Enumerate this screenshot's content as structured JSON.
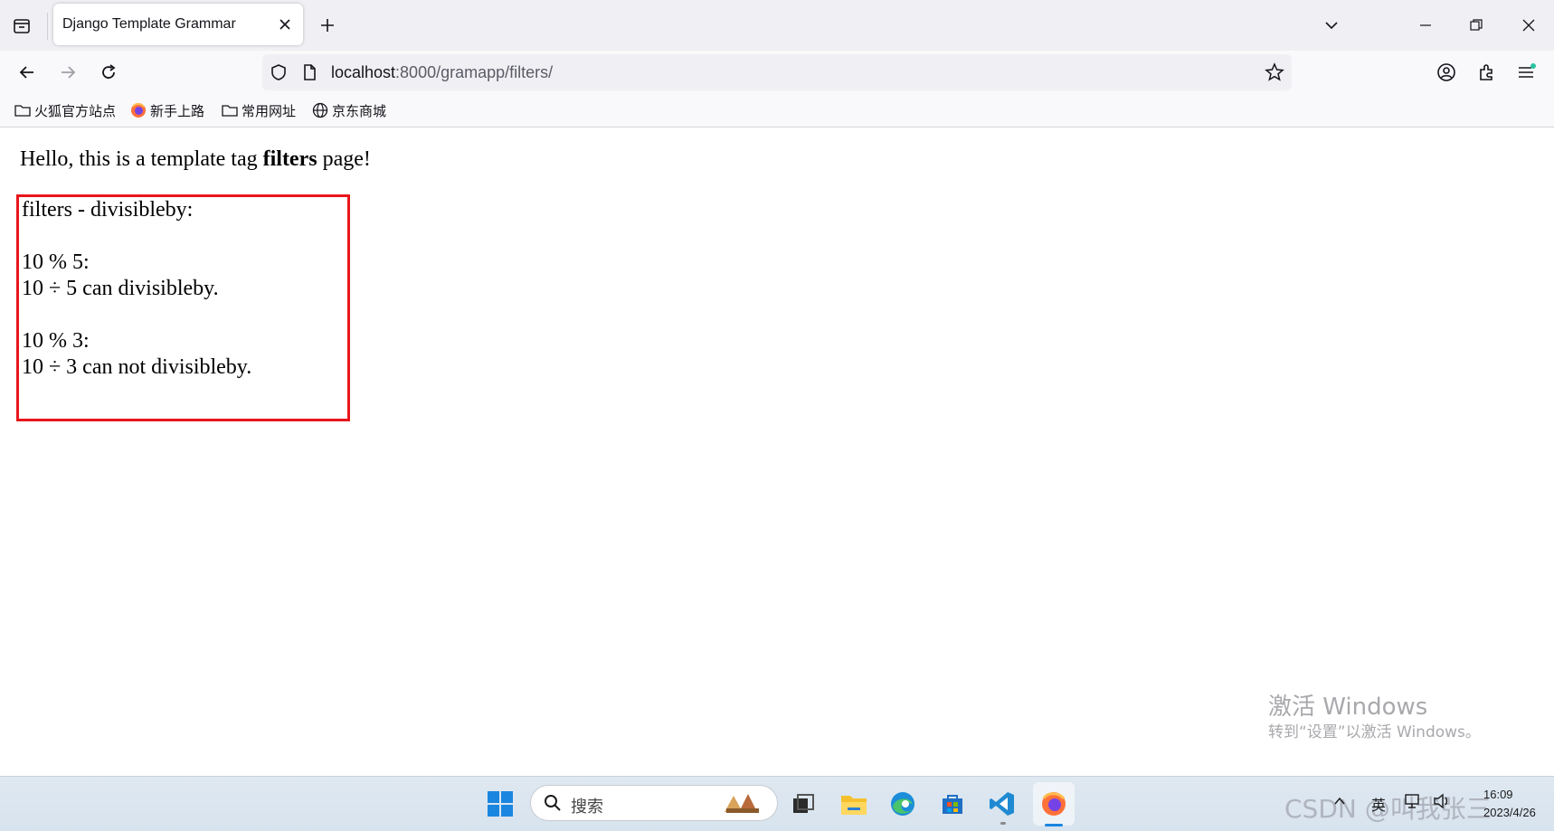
{
  "browser": {
    "tab_title": "Django Template Grammar",
    "url_host": "localhost",
    "url_rest": ":8000/gramapp/filters/"
  },
  "bookmarks": [
    "火狐官方站点",
    "新手上路",
    "常用网址",
    "京东商城"
  ],
  "page": {
    "heading_prefix": "Hello, this is a template tag ",
    "heading_bold": "filters",
    "heading_suffix": " page!",
    "lines": [
      "filters - divisibleby:",
      "10 % 5:",
      "10 ÷ 5 can divisibleby.",
      "10 % 3:",
      "10 ÷ 3 can not divisibleby."
    ]
  },
  "watermark": {
    "line1": "激活 Windows",
    "line2": "转到“设置”以激活 Windows。"
  },
  "taskbar": {
    "search_placeholder": "搜索",
    "input_indicator": "英",
    "time": "16:09",
    "date": "2023/4/26",
    "csdn_watermark": "CSDN @叫我张三"
  }
}
